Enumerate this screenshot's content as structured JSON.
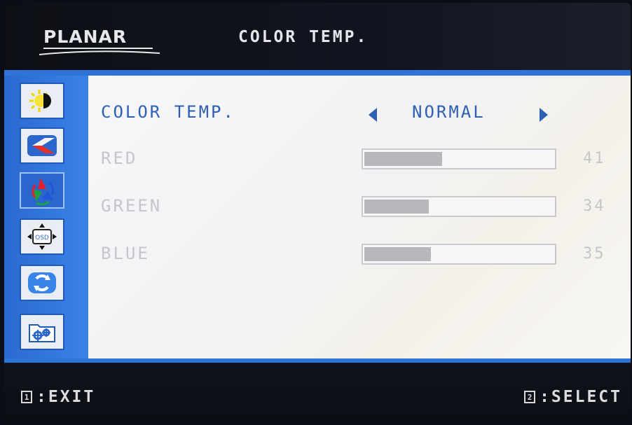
{
  "header": {
    "brand": "PLANAR",
    "title": "COLOR TEMP."
  },
  "sidebar": {
    "items": [
      {
        "name": "brightness-contrast",
        "icon": "sun-contrast-icon"
      },
      {
        "name": "image-setup",
        "icon": "image-setup-icon"
      },
      {
        "name": "color",
        "icon": "rgb-color-icon",
        "active": true
      },
      {
        "name": "osd-settings",
        "icon": "osd-icon"
      },
      {
        "name": "reset",
        "icon": "reset-arrows-icon"
      },
      {
        "name": "misc",
        "icon": "folder-gear-icon"
      }
    ]
  },
  "main": {
    "color_temp": {
      "label": "COLOR TEMP.",
      "value": "NORMAL"
    },
    "channels": [
      {
        "label": "RED",
        "value": "41",
        "level_percent": 41
      },
      {
        "label": "GREEN",
        "value": "34",
        "level_percent": 34
      },
      {
        "label": "BLUE",
        "value": "35",
        "level_percent": 35
      }
    ]
  },
  "footer": {
    "exit_key": "1",
    "exit_label": ":EXIT",
    "select_key": "2",
    "select_label": ":SELECT"
  },
  "colors": {
    "accent_blue": "#2f73d6",
    "label_blue": "#2e5fb2",
    "disabled_gray": "#c5c6ca"
  }
}
